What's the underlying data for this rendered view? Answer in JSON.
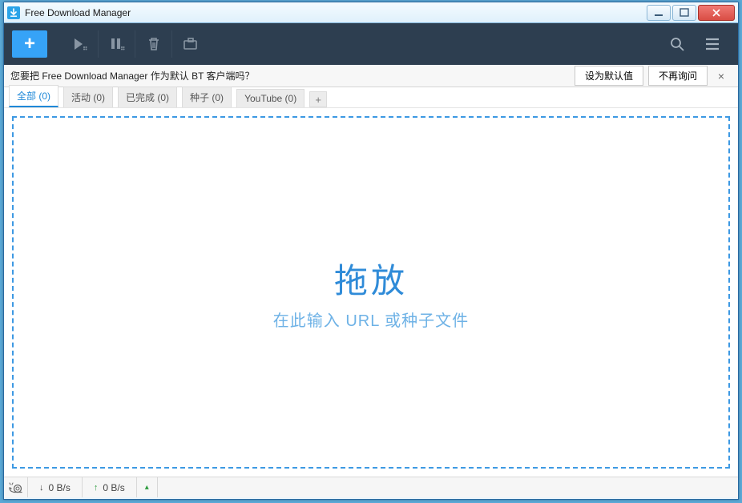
{
  "window": {
    "title": "Free Download Manager"
  },
  "prompt": {
    "message": "您要把 Free Download Manager 作为默认 BT 客户端吗？",
    "set_default": "设为默认值",
    "dont_ask": "不再询问",
    "close": "×"
  },
  "tabs": {
    "items": [
      {
        "label": "全部 (0)",
        "active": true
      },
      {
        "label": "活动 (0)",
        "active": false
      },
      {
        "label": "已完成 (0)",
        "active": false
      },
      {
        "label": "种子 (0)",
        "active": false
      },
      {
        "label": "YouTube (0)",
        "active": false
      }
    ],
    "add": "+"
  },
  "dropzone": {
    "title": "拖放",
    "subtitle": "在此输入 URL 或种子文件"
  },
  "status": {
    "down_speed": "0 B/s",
    "up_speed": "0 B/s"
  },
  "toolbar": {
    "add": "+"
  }
}
